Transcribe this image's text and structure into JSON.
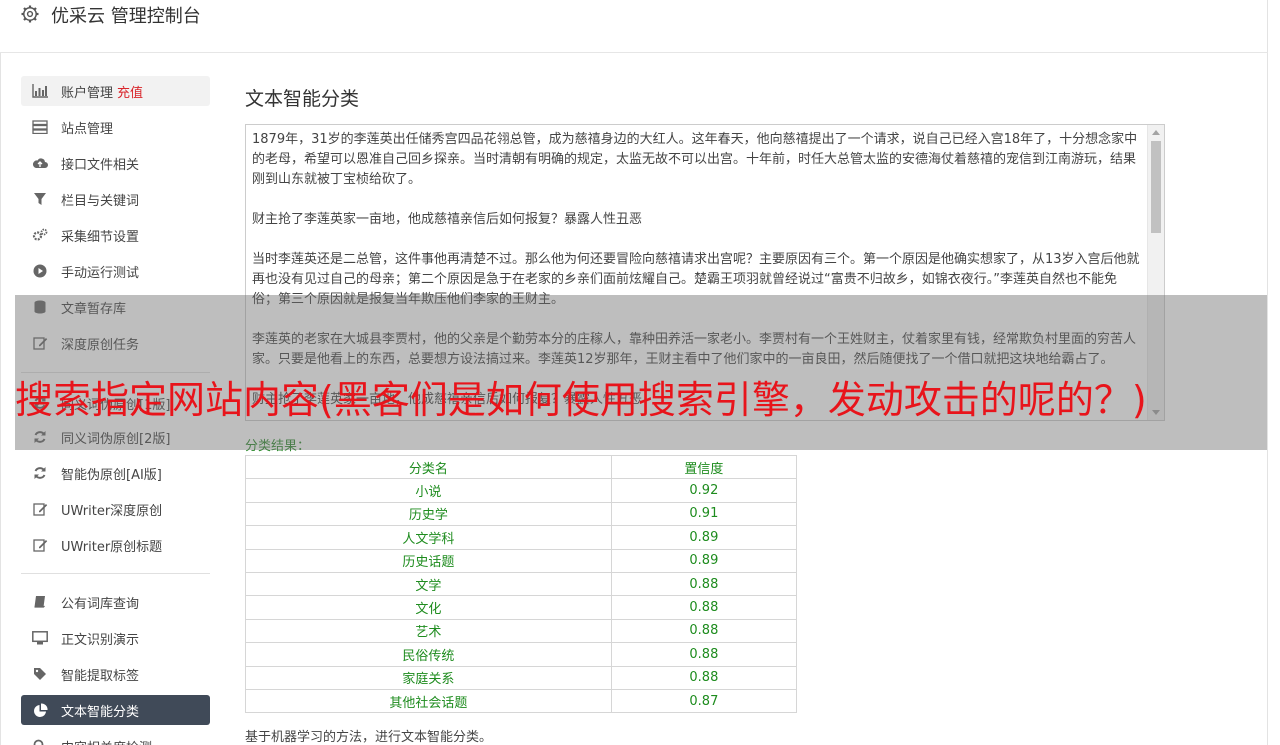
{
  "header": {
    "title": "优采云 管理控制台",
    "icon": "gear-icon"
  },
  "sidebar": {
    "groups": [
      [
        {
          "label": "账户管理",
          "badge": "充值",
          "icon": "bar-chart-icon",
          "state": "hover"
        },
        {
          "label": "站点管理",
          "icon": "server-icon"
        },
        {
          "label": "接口文件相关",
          "icon": "cloud-upload-icon"
        },
        {
          "label": "栏目与关键词",
          "icon": "filter-icon"
        },
        {
          "label": "采集细节设置",
          "icon": "cogs-icon"
        },
        {
          "label": "手动运行测试",
          "icon": "play-circle-icon"
        },
        {
          "label": "文章暂存库",
          "icon": "database-icon"
        },
        {
          "label": "深度原创任务",
          "icon": "edit-icon"
        }
      ],
      [
        {
          "label": "同义词伪原创[1版]",
          "icon": "refresh-icon"
        },
        {
          "label": "同义词伪原创[2版]",
          "icon": "refresh-icon"
        },
        {
          "label": "智能伪原创[AI版]",
          "icon": "refresh-icon"
        },
        {
          "label": "UWriter深度原创",
          "icon": "edit-icon"
        },
        {
          "label": "UWriter原创标题",
          "icon": "edit-icon"
        }
      ],
      [
        {
          "label": "公有词库查询",
          "icon": "book-icon"
        },
        {
          "label": "正文识别演示",
          "icon": "desktop-icon"
        },
        {
          "label": "智能提取标签",
          "icon": "tag-icon"
        },
        {
          "label": "文本智能分类",
          "icon": "pie-chart-icon",
          "state": "active"
        },
        {
          "label": "内容相关度检测",
          "icon": "search-icon"
        }
      ]
    ]
  },
  "main": {
    "title": "文本智能分类",
    "textarea_paragraphs": [
      "1879年，31岁的李莲英出任储秀宫四品花翎总管，成为慈禧身边的大红人。这年春天，他向慈禧提出了一个请求，说自己已经入宫18年了，十分想念家中的老母，希望可以恩准自己回乡探亲。当时清朝有明确的规定，太监无故不可以出宫。十年前，时任大总管太监的安德海仗着慈禧的宠信到江南游玩，结果刚到山东就被丁宝桢给砍了。",
      "财主抢了李莲英家一亩地，他成慈禧亲信后如何报复？暴露人性丑恶",
      "当时李莲英还是二总管，这件事他再清楚不过。那么他为何还要冒险向慈禧请求出宫呢？主要原因有三个。第一个原因是他确实想家了，从13岁入宫后他就再也没有见过自己的母亲；第二个原因是急于在老家的乡亲们面前炫耀自己。楚霸王项羽就曾经说过“富贵不归故乡，如锦衣夜行。”李莲英自然也不能免俗；第三个原因就是报复当年欺压他们李家的王财主。",
      "李莲英的老家在大城县李贾村，他的父亲是个勤劳本分的庄稼人，靠种田养活一家老小。李贾村有一个王姓财主，仗着家里有钱，经常欺负村里面的穷苦人家。只要是他看上的东西，总要想方设法搞过来。李莲英12岁那年，王财主看中了他们家中的一亩良田，然后随便找了一个借口就把这块地给霸占了。",
      "财主抢了李莲英家一亩地，他成慈禧亲信后如何报复？暴露人性丑恶"
    ],
    "result_label": "分类结果：",
    "table": {
      "headers": [
        "分类名",
        "置信度"
      ],
      "rows": [
        [
          "小说",
          "0.92"
        ],
        [
          "历史学",
          "0.91"
        ],
        [
          "人文学科",
          "0.89"
        ],
        [
          "历史话题",
          "0.89"
        ],
        [
          "文学",
          "0.88"
        ],
        [
          "文化",
          "0.88"
        ],
        [
          "艺术",
          "0.88"
        ],
        [
          "民俗传统",
          "0.88"
        ],
        [
          "家庭关系",
          "0.88"
        ],
        [
          "其他社会话题",
          "0.87"
        ]
      ]
    },
    "footnote": "基于机器学习的方法，进行文本智能分类。"
  },
  "overlay": {
    "text": "搜索指定网站内容(黑客们是如何使用搜索引擎，发动攻击的呢的？)"
  },
  "colors": {
    "active_bg": "#404a58",
    "table_text": "#1e8c1e",
    "badge": "#d9252b",
    "overlay_text": "#e8141b"
  }
}
